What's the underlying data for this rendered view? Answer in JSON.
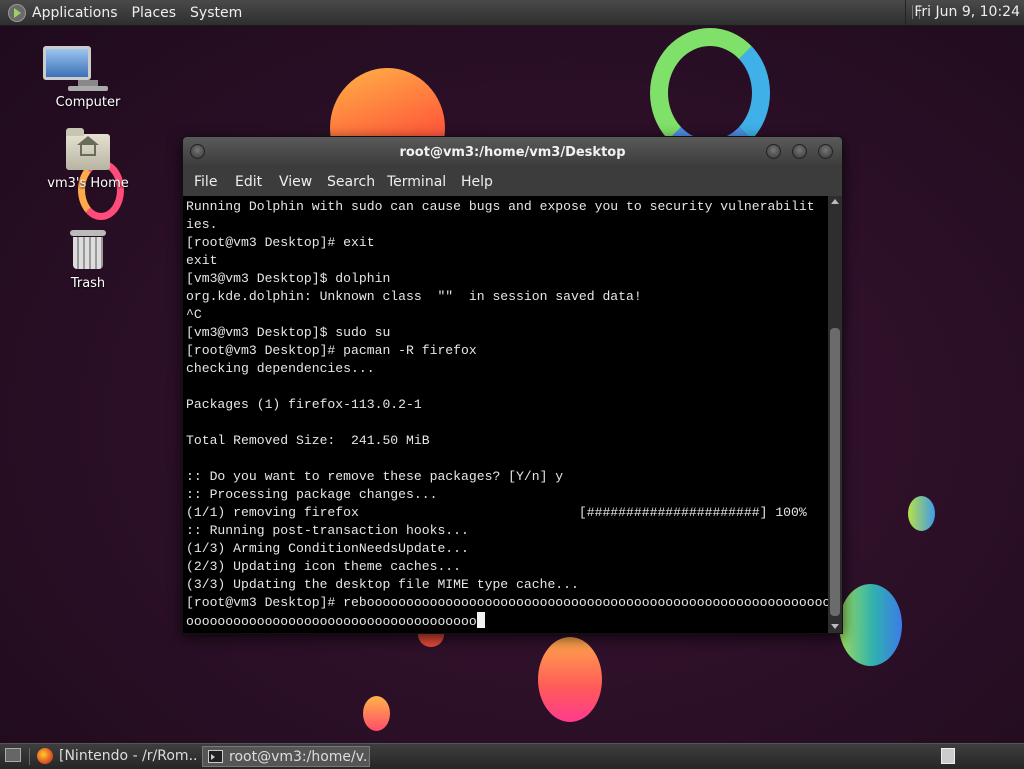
{
  "top_panel": {
    "menus": [
      "Applications",
      "Places",
      "System"
    ],
    "clock": "Fri Jun  9, 10:24"
  },
  "desktop": {
    "icons": [
      {
        "label": "Computer",
        "icon": "computer-icon"
      },
      {
        "label": "vm3's Home",
        "icon": "home-folder-icon"
      },
      {
        "label": "Trash",
        "icon": "trash-icon"
      }
    ]
  },
  "terminal": {
    "title": "root@vm3:/home/vm3/Desktop",
    "menu": [
      "File",
      "Edit",
      "View",
      "Search",
      "Terminal",
      "Help"
    ],
    "lines": [
      "Running Dolphin with sudo can cause bugs and expose you to security vulnerabilit",
      "ies.",
      "[root@vm3 Desktop]# exit",
      "exit",
      "[vm3@vm3 Desktop]$ dolphin",
      "org.kde.dolphin: Unknown class  \"\"  in session saved data!",
      "^C",
      "[vm3@vm3 Desktop]$ sudo su",
      "[root@vm3 Desktop]# pacman -R firefox",
      "checking dependencies...",
      "",
      "Packages (1) firefox-113.0.2-1",
      "",
      "Total Removed Size:  241.50 MiB",
      "",
      ":: Do you want to remove these packages? [Y/n] y",
      ":: Processing package changes...",
      "(1/1) removing firefox                            [######################] 100%",
      ":: Running post-transaction hooks...",
      "(1/3) Arming ConditionNeedsUpdate...",
      "(2/3) Updating icon theme caches...",
      "(3/3) Updating the desktop file MIME type cache...",
      "[root@vm3 Desktop]# rebooooooooooooooooooooooooooooooooooooooooooooooooooooooooooo"
    ],
    "input_line": "ooooooooooooooooooooooooooooooooooooo"
  },
  "taskbar": {
    "tasks": [
      {
        "label": "[Nintendo - /r/Rom...",
        "icon": "firefox-icon",
        "active": false
      },
      {
        "label": "root@vm3:/home/v...",
        "icon": "terminal-icon",
        "active": true
      }
    ]
  }
}
